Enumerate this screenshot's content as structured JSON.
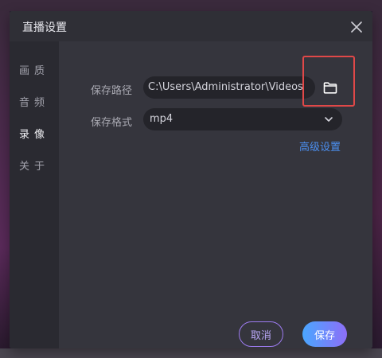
{
  "dialog": {
    "title": "直播设置",
    "close_icon": "close-icon"
  },
  "sidebar": {
    "items": [
      {
        "label": "画质",
        "active": false
      },
      {
        "label": "音频",
        "active": false
      },
      {
        "label": "录像",
        "active": true
      },
      {
        "label": "关于",
        "active": false
      }
    ]
  },
  "record": {
    "path_label": "保存路径",
    "path_value": "C:\\Users\\Administrator\\Videos",
    "folder_icon": "folder-icon",
    "format_label": "保存格式",
    "format_value": "mp4",
    "advanced_link": "高级设置"
  },
  "buttons": {
    "cancel": "取消",
    "save": "保存"
  },
  "colors": {
    "accent_link": "#4b8ff0",
    "highlight": "#e04848",
    "save_gradient_start": "#4aa6ff",
    "save_gradient_end": "#8d6ff7"
  }
}
